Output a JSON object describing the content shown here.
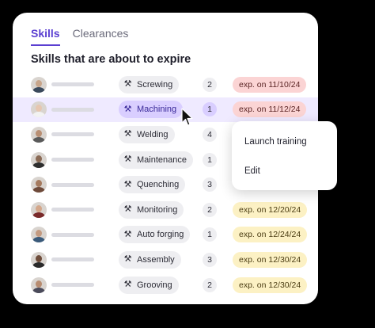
{
  "tabs": [
    {
      "label": "Skills",
      "active": true
    },
    {
      "label": "Clearances",
      "active": false
    }
  ],
  "section_title": "Skills that are about to expire",
  "rows": [
    {
      "skill": "Screwing",
      "count": "2",
      "expiry": "exp. on 11/10/24",
      "status": "red",
      "avatar_tone": "#c8a58a",
      "shirt": "#3b4a5c",
      "highlight": false
    },
    {
      "skill": "Machining",
      "count": "1",
      "expiry": "exp. on 11/12/24",
      "status": "red",
      "avatar_tone": "#e6c6b0",
      "shirt": "#f2f2f2",
      "highlight": true
    },
    {
      "skill": "Welding",
      "count": "4",
      "expiry": "",
      "status": "",
      "avatar_tone": "#b98f73",
      "shirt": "#5a5a5a",
      "highlight": false
    },
    {
      "skill": "Maintenance",
      "count": "1",
      "expiry": "",
      "status": "",
      "avatar_tone": "#8a6a55",
      "shirt": "#2e2e2e",
      "highlight": false
    },
    {
      "skill": "Quenching",
      "count": "3",
      "expiry": "",
      "status": "",
      "avatar_tone": "#a57a5e",
      "shirt": "#6e4a3a",
      "highlight": false
    },
    {
      "skill": "Monitoring",
      "count": "2",
      "expiry": "exp. on 12/20/24",
      "status": "yellow",
      "avatar_tone": "#d4a78a",
      "shirt": "#7a2a2a",
      "highlight": false
    },
    {
      "skill": "Auto forging",
      "count": "1",
      "expiry": "exp. on 12/24/24",
      "status": "yellow",
      "avatar_tone": "#c39a80",
      "shirt": "#3a5a7a",
      "highlight": false
    },
    {
      "skill": "Assembly",
      "count": "3",
      "expiry": "exp. on 12/30/24",
      "status": "yellow",
      "avatar_tone": "#6e4c3a",
      "shirt": "#2a2a2a",
      "highlight": false
    },
    {
      "skill": "Grooving",
      "count": "2",
      "expiry": "exp. on 12/30/24",
      "status": "yellow",
      "avatar_tone": "#b88c70",
      "shirt": "#4a4a5a",
      "highlight": false
    }
  ],
  "context_menu": {
    "items": [
      "Launch training",
      "Edit"
    ]
  },
  "icons": {
    "skill_icon": "tools-icon",
    "cursor": "pointer-cursor-icon"
  }
}
